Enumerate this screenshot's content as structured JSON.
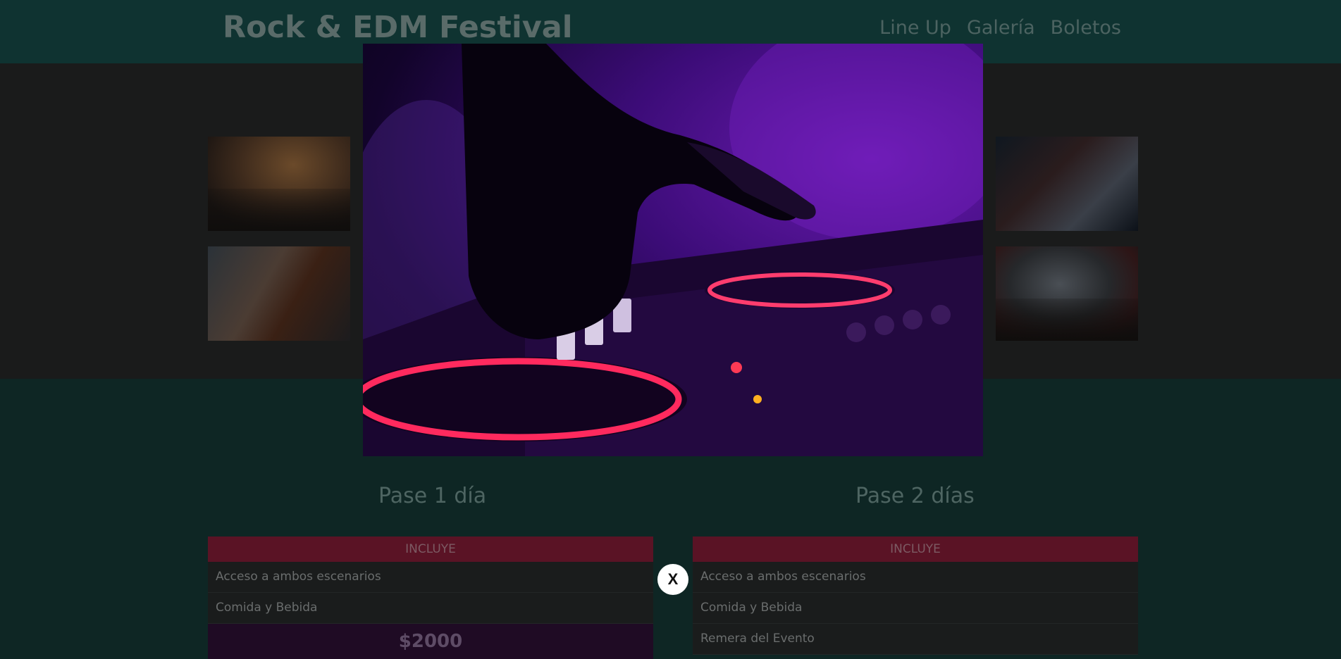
{
  "header": {
    "title": "Rock & EDM Festival",
    "nav": [
      "Line Up",
      "Galería",
      "Boletos"
    ]
  },
  "gallery": {
    "thumbnails": [
      "crowd-concert-photo",
      "guitarists-photo",
      "dj-drums-photo",
      "smoke-performer-photo"
    ]
  },
  "pricing": {
    "plans": [
      {
        "title": "Pase 1 día",
        "includes_label": "INCLUYE",
        "items": [
          "Acceso a ambos escenarios",
          "Comida y Bebida"
        ],
        "price": "$2000"
      },
      {
        "title": "Pase 2 días",
        "includes_label": "INCLUYE",
        "items": [
          "Acceso a ambos escenarios",
          "Comida y Bebida",
          "Remera del Evento"
        ]
      }
    ]
  },
  "lightbox": {
    "image": "dj-mixer-photo",
    "close_label": "X"
  },
  "colors": {
    "accent_red": "#e0234e",
    "accent_purple": "#6a1ab0",
    "header_bg": "#0f3331"
  }
}
